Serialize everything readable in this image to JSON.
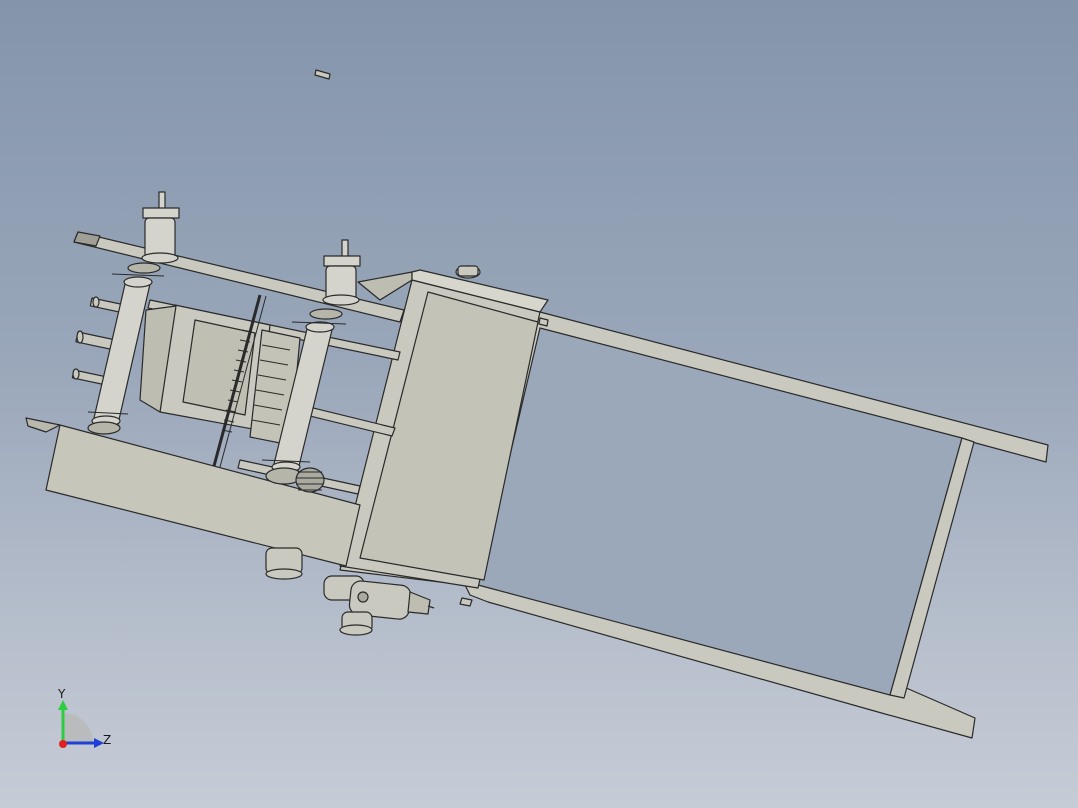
{
  "viewport": {
    "background_top": "#8495ab",
    "background_bottom": "#c6ccd6"
  },
  "model": {
    "part_fill": "#c9c9bf",
    "part_fill_dark": "#b5b5aa",
    "edge_color": "#2a2a2a",
    "shaft_fill": "#d4d4cc"
  },
  "triad": {
    "y_label": "Y",
    "z_label": "Z",
    "y_color": "#2ecc40",
    "z_color": "#1f3fd6",
    "origin_color": "#e02020"
  }
}
